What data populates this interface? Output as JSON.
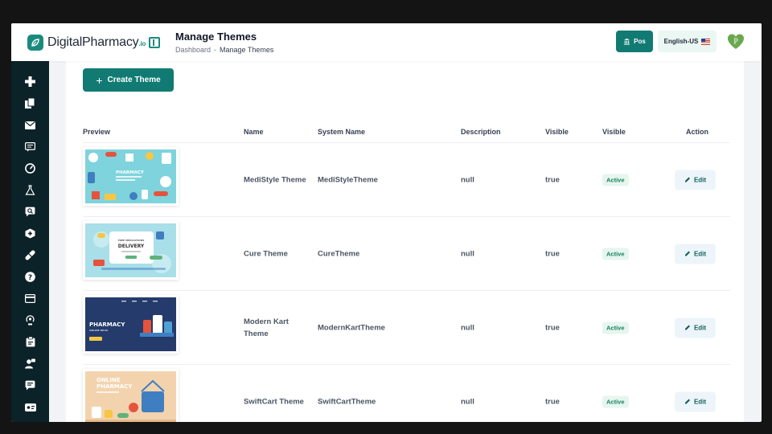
{
  "app": {
    "logo_main": "DigitalPharmacy",
    "logo_suffix": ".io",
    "logo_icon": "leaf-icon"
  },
  "header": {
    "title": "Manage Themes",
    "breadcrumb": [
      "Dashboard",
      "Manage Themes"
    ],
    "pos_label": "Pos",
    "language_label": "English-US",
    "avatar_letter": "P"
  },
  "sidebar": {
    "items": [
      {
        "icon": "plus-icon"
      },
      {
        "icon": "documents-icon"
      },
      {
        "icon": "mail-icon"
      },
      {
        "icon": "message-icon"
      },
      {
        "icon": "gauge-icon"
      },
      {
        "icon": "flask-icon"
      },
      {
        "icon": "chat-search-icon"
      },
      {
        "icon": "medicine-box-icon"
      },
      {
        "icon": "pill-icon"
      },
      {
        "icon": "help-icon"
      },
      {
        "icon": "card-icon"
      },
      {
        "icon": "broadcast-icon"
      },
      {
        "icon": "clipboard-icon"
      },
      {
        "icon": "user-chat-icon"
      },
      {
        "icon": "comment-icon"
      },
      {
        "icon": "id-card-icon"
      }
    ]
  },
  "toolbar": {
    "create_label": "Create Theme"
  },
  "table": {
    "columns": [
      "Preview",
      "Name",
      "System Name",
      "Description",
      "Visible",
      "Visible",
      "Action"
    ],
    "rows": [
      {
        "name": "MediStyle Theme",
        "system_name": "MediStyleTheme",
        "description": "null",
        "visible": "true",
        "status": "Active",
        "action": "Edit",
        "preview_text": [
          "PHARMACY"
        ]
      },
      {
        "name": "Cure Theme",
        "system_name": "CureTheme",
        "description": "null",
        "visible": "true",
        "status": "Active",
        "action": "Edit",
        "preview_text": [
          "FREE MEDICATIONS",
          "DELIVERY"
        ]
      },
      {
        "name": "Modern Kart Theme",
        "system_name": "ModernKartTheme",
        "description": "null",
        "visible": "true",
        "status": "Active",
        "action": "Edit",
        "preview_text": [
          "PHARMACY",
          "ONLINE DRUG"
        ]
      },
      {
        "name": "SwiftCart Theme",
        "system_name": "SwiftCartTheme",
        "description": "null",
        "visible": "true",
        "status": "Active",
        "action": "Edit",
        "preview_text": [
          "ONLINE",
          "PHARMACY"
        ]
      }
    ]
  },
  "colors": {
    "primary": "#117b73",
    "sidebar": "#0c2229",
    "badge_bg": "#e6f6ef",
    "badge_text": "#16805f"
  }
}
